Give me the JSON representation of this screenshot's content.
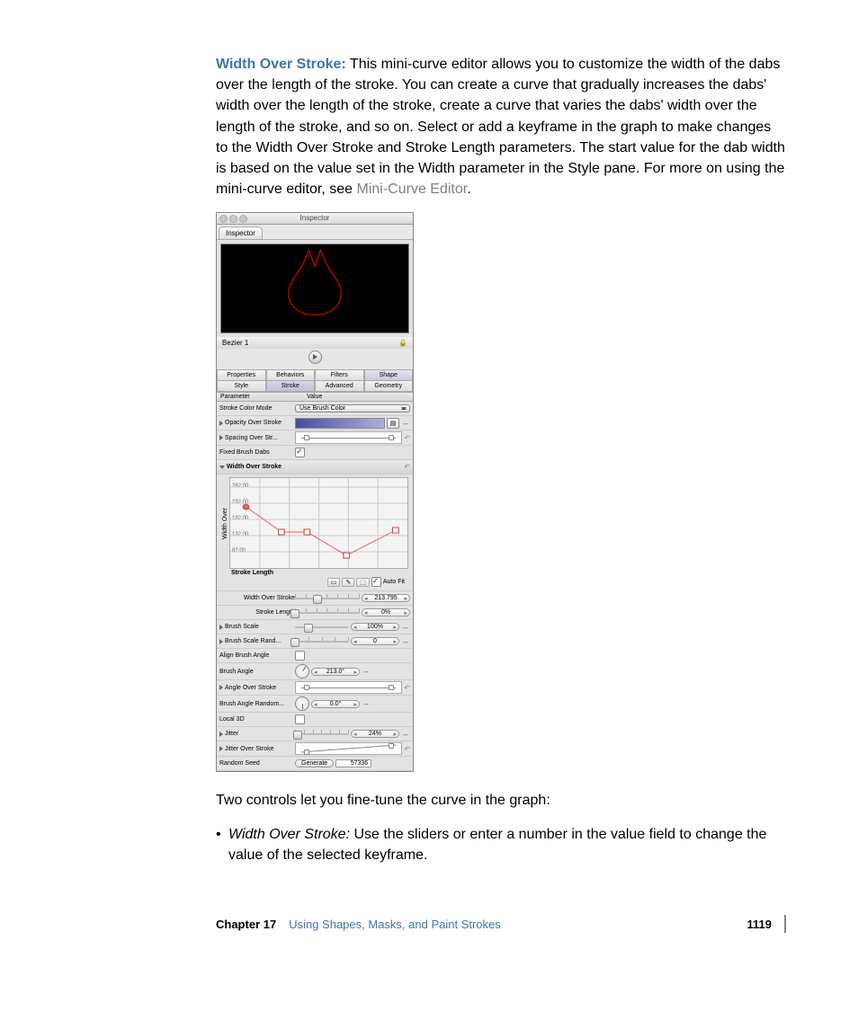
{
  "para1": {
    "label": "Width Over Stroke:",
    "text": "  This mini-curve editor allows you to customize the width of the dabs over the length of the stroke. You can create a curve that gradually increases the dabs' width over the length of the stroke, create a curve that varies the dabs' width over the length of the stroke, and so on. Select or add a keyframe in the graph to make changes to the Width Over Stroke and Stroke Length parameters. The start value for the dab width is based on the value set in the Width parameter in the Style pane. For more on using the mini-curve editor, see ",
    "link": "Mini-Curve Editor",
    "tail": "."
  },
  "para2": "Two controls let you fine-tune the curve in the graph:",
  "bullet": {
    "label": "Width Over Stroke:",
    "text": "  Use the sliders or enter a number in the value field to change the value of the selected keyframe."
  },
  "inspector": {
    "window_title": "Inspector",
    "tab": "Inspector",
    "object": "Bezier 1",
    "tabs4": [
      "Properties",
      "Behaviors",
      "Filters",
      "Shape"
    ],
    "tabs4b": [
      "Style",
      "Stroke",
      "Advanced",
      "Geometry"
    ],
    "hdr": [
      "Parameter",
      "Value"
    ],
    "rows": {
      "stroke_color_mode": {
        "lbl": "Stroke Color Mode",
        "val": "Use Brush Color"
      },
      "opacity": {
        "lbl": "Opacity Over Stroke"
      },
      "spacing": {
        "lbl": "Spacing Over Str..."
      },
      "fixed": {
        "lbl": "Fixed Brush Dabs"
      },
      "wos": {
        "lbl": "Width Over Stroke"
      },
      "wos_val": {
        "lbl": "Width Over Stroke",
        "val": "213.795"
      },
      "stroke_len": {
        "lbl": "Stroke Length",
        "val": "0%"
      },
      "brush_scale": {
        "lbl": "Brush Scale",
        "val": "100%"
      },
      "brush_scale_rand": {
        "lbl": "Brush Scale Rand...",
        "val": "0"
      },
      "align": {
        "lbl": "Align Brush Angle"
      },
      "brush_angle": {
        "lbl": "Brush Angle",
        "val": "213.0°"
      },
      "angle_over": {
        "lbl": "Angle Over Stroke"
      },
      "angle_rand": {
        "lbl": "Brush Angle Random...",
        "val": "0.0°"
      },
      "local3d": {
        "lbl": "Local 3D"
      },
      "jitter": {
        "lbl": "Jitter",
        "val": "24%"
      },
      "jitter_over": {
        "lbl": "Jitter Over Stroke"
      },
      "seed": {
        "lbl": "Random Seed",
        "gen": "Generate",
        "val": "57336"
      }
    },
    "graph": {
      "ylabel": "Width Over",
      "xlabel": "Stroke Length",
      "yticks": [
        "282.00",
        "232.00",
        "182.00",
        "132.00",
        "82.00"
      ],
      "autofit": "Auto Fit"
    }
  },
  "footer": {
    "chapter": "Chapter 17",
    "title": "Using Shapes, Masks, and Paint Strokes",
    "page": "1119"
  }
}
